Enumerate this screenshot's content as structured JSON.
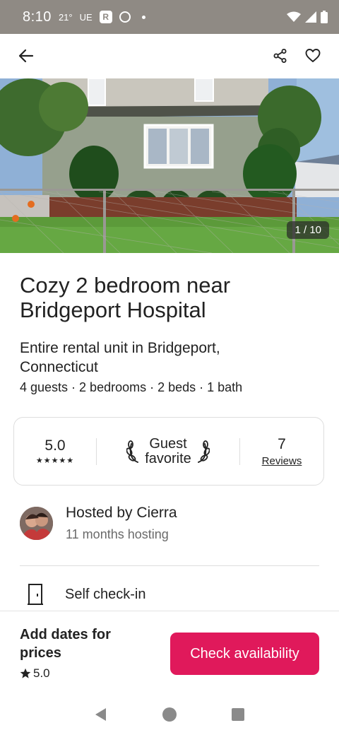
{
  "status_bar": {
    "time": "8:10",
    "temp": "21°",
    "carrier": "UE",
    "app_badge": "R"
  },
  "listing": {
    "photo_counter": "1 / 10",
    "title": "Cozy 2 bedroom near Bridgeport Hospital",
    "subtitle": "Entire rental unit in Bridgeport, Connecticut",
    "details": "4 guests · 2 bedrooms · 2 beds · 1 bath"
  },
  "rating_card": {
    "rating": "5.0",
    "stars": "★★★★★",
    "guest_favorite_line1": "Guest",
    "guest_favorite_line2": "favorite",
    "reviews_count": "7",
    "reviews_label": "Reviews"
  },
  "host": {
    "name": "Hosted by Cierra",
    "meta": "11 months hosting"
  },
  "features": [
    {
      "label": "Self check-in",
      "icon": "door-icon"
    }
  ],
  "bottom_bar": {
    "price_label": "Add dates for prices",
    "rating": "5.0",
    "cta_label": "Check availability"
  },
  "colors": {
    "accent": "#e0195b",
    "status_bar": "#8f8a84"
  }
}
